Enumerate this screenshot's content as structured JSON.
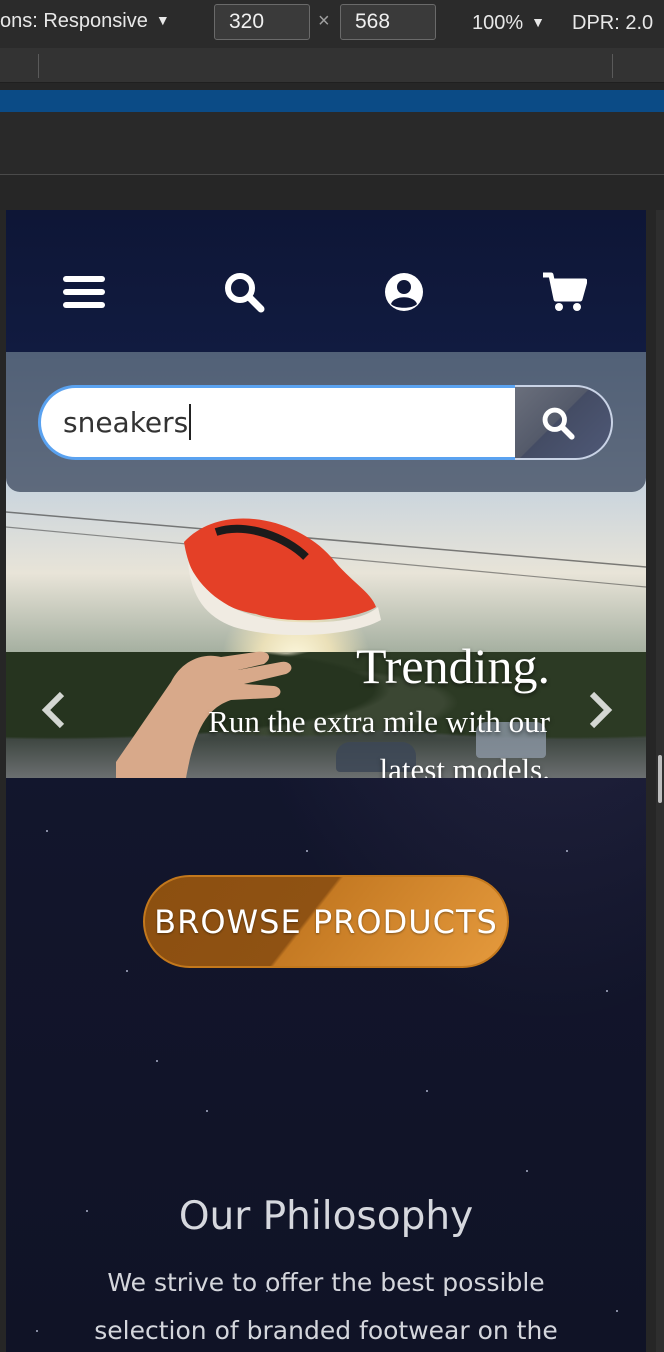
{
  "devtools": {
    "device_label": "ons: Responsive",
    "width": "320",
    "height": "568",
    "times": "×",
    "zoom": "100%",
    "dpr": "DPR: 2.0"
  },
  "nav": {
    "icons": [
      "menu-icon",
      "search-icon",
      "user-icon",
      "cart-icon"
    ]
  },
  "search": {
    "value": "sneakers",
    "button_icon": "search-icon"
  },
  "hero": {
    "title": "Trending.",
    "text": "Run the extra mile with our latest models.",
    "prev_icon": "chevron-left-icon",
    "next_icon": "chevron-right-icon"
  },
  "cta": {
    "label": "BROWSE PRODUCTS"
  },
  "philosophy": {
    "title": "Our Philosophy",
    "text": "We strive to offer the best possible selection of branded footwear on the"
  },
  "colors": {
    "accent": "#e59a3d",
    "focus_border": "#5aa2f0",
    "background": "#12152b"
  }
}
